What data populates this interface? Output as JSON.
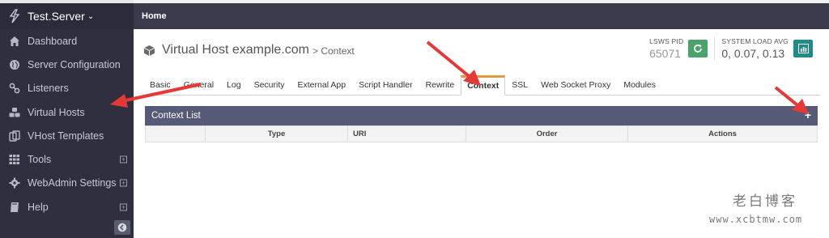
{
  "app": {
    "server_name": "Test.Server",
    "header_title": "Home"
  },
  "sidebar": {
    "items": [
      {
        "label": "Dashboard",
        "icon": "home-icon"
      },
      {
        "label": "Server Configuration",
        "icon": "globe-icon"
      },
      {
        "label": "Listeners",
        "icon": "link-icon"
      },
      {
        "label": "Virtual Hosts",
        "icon": "cubes-icon"
      },
      {
        "label": "VHost Templates",
        "icon": "copy-icon"
      },
      {
        "label": "Tools",
        "icon": "grid-icon",
        "expandable": true
      },
      {
        "label": "WebAdmin Settings",
        "icon": "gear-icon",
        "expandable": true
      },
      {
        "label": "Help",
        "icon": "book-icon",
        "expandable": true
      }
    ]
  },
  "page": {
    "title": "Virtual Host example.com",
    "breadcrumb": "> Context"
  },
  "stats": {
    "pid_label": "LSWS PID",
    "pid_value": "65071",
    "load_label": "SYSTEM LOAD AVG",
    "load_value": "0, 0.07, 0.13"
  },
  "tabs": [
    "Basic",
    "General",
    "Log",
    "Security",
    "External App",
    "Script Handler",
    "Rewrite",
    "Context",
    "SSL",
    "Web Socket Proxy",
    "Modules"
  ],
  "active_tab": "Context",
  "context_list": {
    "title": "Context List",
    "add_symbol": "+",
    "columns": [
      "",
      "Type",
      "URI",
      "Order",
      "Actions"
    ]
  },
  "watermark": {
    "line1": "老白博客",
    "line2": "www.xcbtmw.com"
  },
  "colors": {
    "sidebar_bg": "#2f2f3f",
    "topbar_bg": "#3a3a4c",
    "panel_header_bg": "#555a77",
    "active_tab_accent": "#e39a3e",
    "annotation_arrow": "#e53935",
    "restart_button": "#4aa36b",
    "chart_button": "#1f8b8b"
  }
}
